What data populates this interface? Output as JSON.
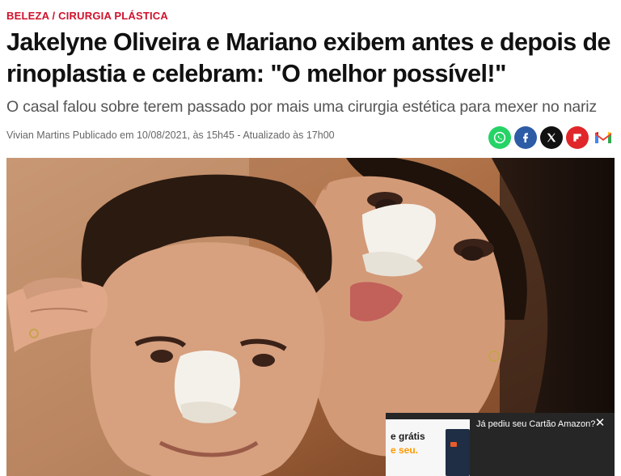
{
  "breadcrumb": {
    "section": "BELEZA",
    "separator": " / ",
    "subsection": "CIRURGIA PLÁSTICA"
  },
  "article": {
    "headline": "Jakelyne Oliveira e Mariano exibem antes e depois de rinoplastia e celebram: \"O melhor possível!\"",
    "subtitle": "O casal falou sobre terem passado por mais uma cirurgia estética para mexer no nariz",
    "byline": "Vivian Martins Publicado em 10/08/2021, às 15h45 - Atualizado às 17h00"
  },
  "share": {
    "icons": [
      "whatsapp-icon",
      "facebook-icon",
      "x-icon",
      "flipboard-icon",
      "gmail-icon"
    ],
    "colors": {
      "whatsapp": "#25d366",
      "facebook": "#2d5ca6",
      "x": "#111111",
      "flipboard": "#e0262a"
    }
  },
  "ad": {
    "left_line1": "e grátis",
    "left_line2": "e seu.",
    "text": "Já pediu seu Cartão Amazon?",
    "close": "✕"
  },
  "colors": {
    "accent": "#d0112b"
  }
}
